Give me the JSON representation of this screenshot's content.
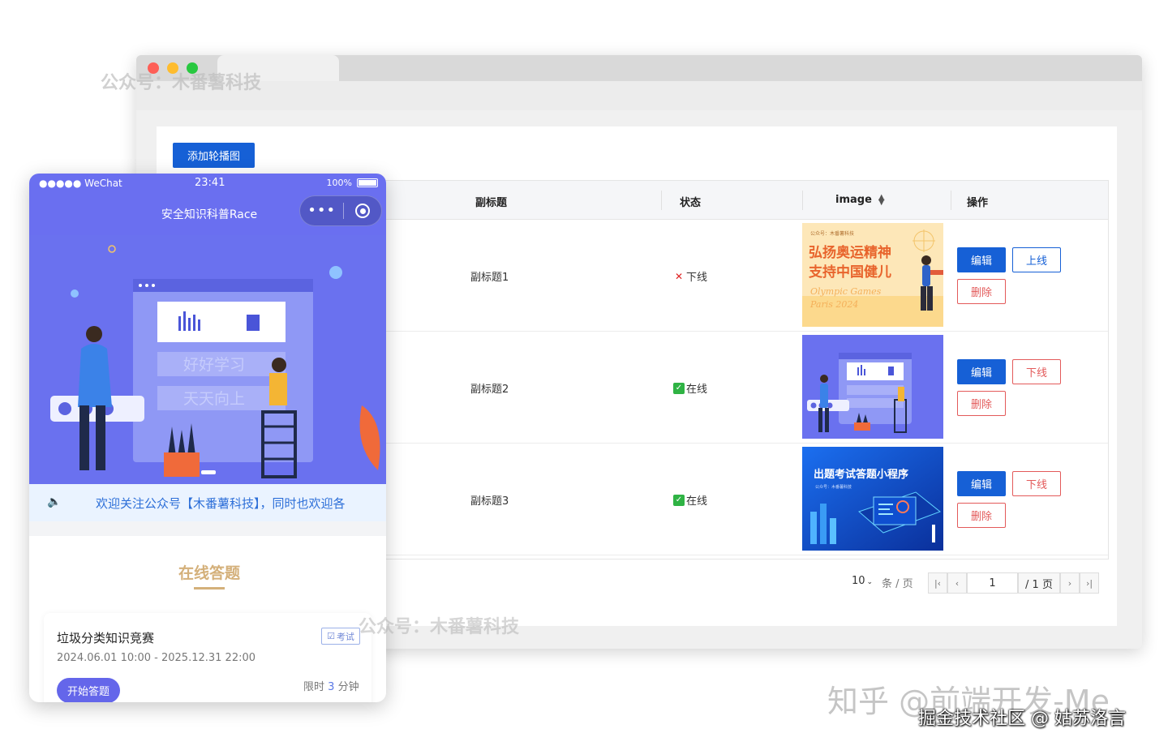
{
  "window": {
    "add_button": "添加轮播图",
    "columns": {
      "subtitle": "副标题",
      "status": "状态",
      "image": "image",
      "actions": "操作"
    },
    "rows": [
      {
        "subtitle": "副标题1",
        "status": "下线",
        "status_type": "offline",
        "toggle": "上线",
        "edit": "编辑",
        "delete": "删除",
        "image_text": {
          "line1": "弘扬奥运精神",
          "line2": "支持中国健儿",
          "script1": "Olympic Games",
          "script2": "Paris 2024",
          "tiny": "公众号：木番薯科技"
        }
      },
      {
        "subtitle": "副标题2",
        "status": "在线",
        "status_type": "online",
        "toggle": "下线",
        "edit": "编辑",
        "delete": "删除"
      },
      {
        "subtitle": "副标题3",
        "status": "在线",
        "status_type": "online",
        "toggle": "下线",
        "edit": "编辑",
        "delete": "删除",
        "image_text": {
          "title": "出题考试答题小程序",
          "tiny": "公众号：木番薯科技"
        }
      }
    ],
    "pagination": {
      "page_size": "10",
      "per_page_unit": "条 / 页",
      "current_page": "1",
      "total": "/ 1 页"
    }
  },
  "phone": {
    "status_bar": {
      "carrier": "●●●●● WeChat",
      "time": "23:41",
      "battery": "100%"
    },
    "app_title": "安全知识科普Race",
    "banner": {
      "label1": "好好学习",
      "label2": "天天向上"
    },
    "notice": "欢迎关注公众号【木番薯科技】，同时也欢迎各",
    "section_title": "在线答题",
    "card": {
      "title": "垃圾分类知识竞赛",
      "tag": "考试",
      "date_range": "2024.06.01 10:00 - 2025.12.31 22:00",
      "limit_prefix": "限时",
      "limit_value": "3",
      "limit_suffix": "分钟",
      "start_button": "开始答题"
    }
  },
  "watermarks": {
    "top": "公众号：木番薯科技",
    "middle": "公众号：木番薯科技",
    "zhihu": "知乎 @前端开发-Me",
    "juejin": "掘金技术社区 @ 姑苏洛言"
  },
  "colors": {
    "primary": "#1660d6",
    "danger": "#e35a5a",
    "phone_theme": "#6a6ff0",
    "gold": "#d4b07a"
  }
}
